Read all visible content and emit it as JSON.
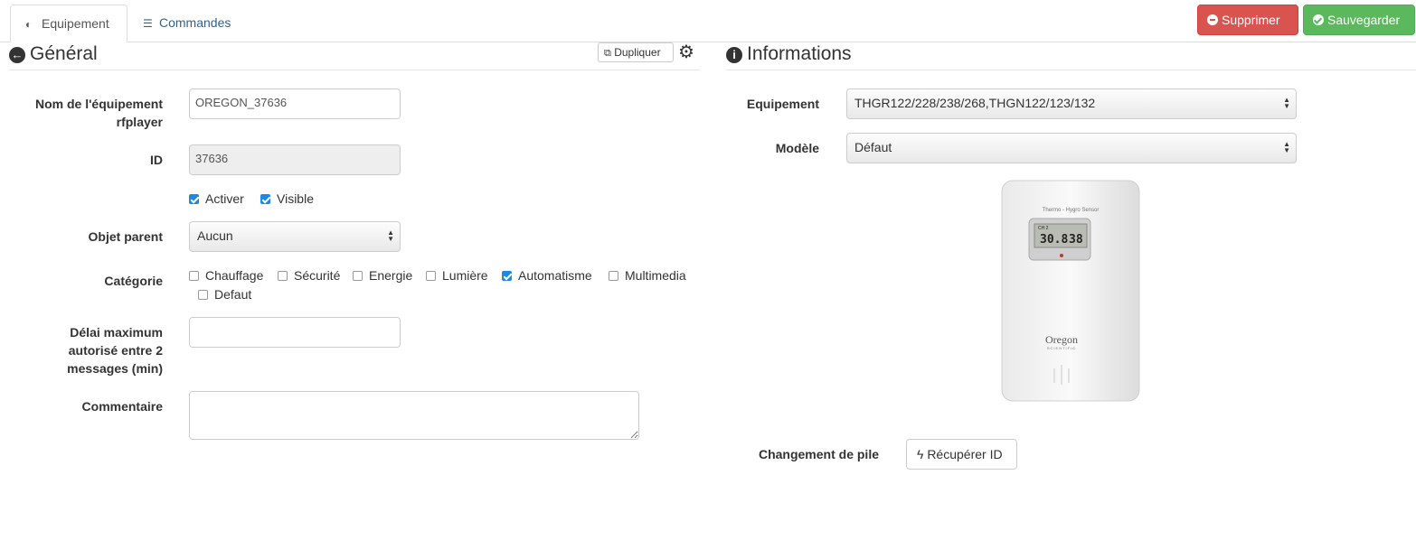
{
  "tabs": [
    {
      "label": "Equipement",
      "icon": "dashboard-icon",
      "active": true
    },
    {
      "label": "Commandes",
      "icon": "list-icon",
      "active": false
    }
  ],
  "actions": {
    "delete_label": "Supprimer",
    "save_label": "Sauvegarder",
    "delete_color": "#d9534f",
    "save_color": "#5cb85c"
  },
  "general": {
    "title": "Général",
    "duplicate_label": "Dupliquer",
    "name_label": "Nom de l'équipement rfplayer",
    "name_value": "OREGON_37636",
    "id_label": "ID",
    "id_value": "37636",
    "activate_label": "Activer",
    "activate_checked": true,
    "visible_label": "Visible",
    "visible_checked": true,
    "parent_label": "Objet parent",
    "parent_value": "Aucun",
    "category_label": "Catégorie",
    "categories": [
      {
        "label": "Chauffage",
        "checked": false
      },
      {
        "label": "Sécurité",
        "checked": false
      },
      {
        "label": "Energie",
        "checked": false
      },
      {
        "label": "Lumière",
        "checked": false
      },
      {
        "label": "Automatisme",
        "checked": true
      },
      {
        "label": "Multimedia",
        "checked": false
      },
      {
        "label": "Defaut",
        "checked": false
      }
    ],
    "delay_label": "Délai maximum autorisé entre 2 messages (min)",
    "delay_value": "",
    "comment_label": "Commentaire",
    "comment_value": ""
  },
  "informations": {
    "title": "Informations",
    "equipment_label": "Equipement",
    "equipment_value": "THGR122/228/238/268,THGN122/123/132",
    "model_label": "Modèle",
    "model_value": "Défaut",
    "device_image": {
      "brand": "Oregon",
      "brand_sub": "SCIENTIFIC",
      "caption": "Thermo - Hygro Sensor",
      "display_ch": "CH 2",
      "display_temp": "30.8",
      "display_hum": "38"
    },
    "battery_label": "Changement de pile",
    "recover_label": "Récupérer ID"
  }
}
